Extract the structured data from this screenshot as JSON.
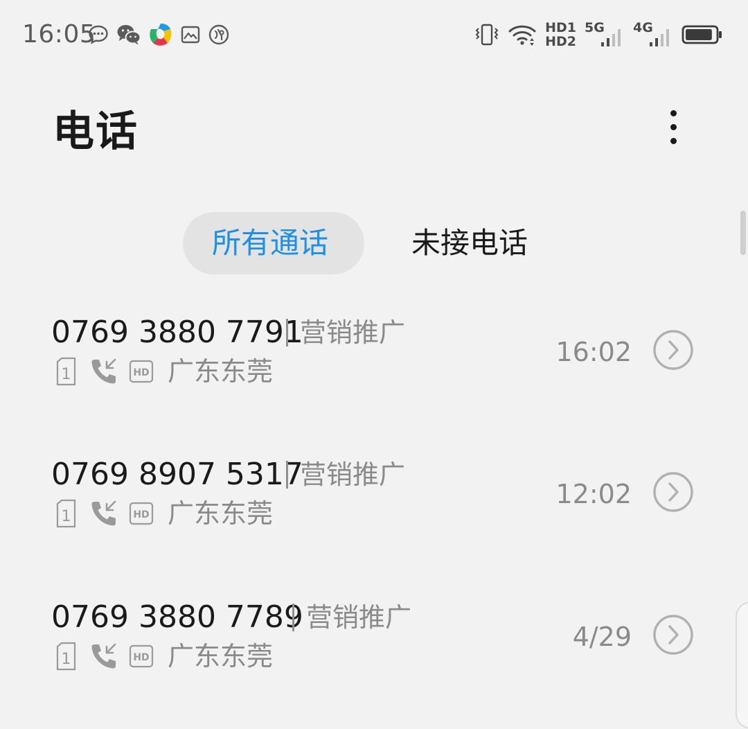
{
  "status_bar": {
    "time": "16:05",
    "left_icons": [
      "chat-bubble-icon",
      "wechat-icon",
      "colorful-app-icon",
      "gallery-icon",
      "nfc-icon"
    ],
    "right_icons": [
      "vibrate-icon",
      "wifi-icon",
      "hd-voice-icon",
      "signal-5g-icon",
      "signal-4g-icon",
      "battery-icon"
    ],
    "hd1_label": "HD1",
    "hd2_label": "HD2",
    "net1_label": "5G",
    "net2_label": "4G",
    "battery_level": 0.9
  },
  "header": {
    "title": "电话",
    "more_icon": "more-vertical-icon"
  },
  "tabs": [
    {
      "label": "所有通话",
      "active": true
    },
    {
      "label": "未接电话",
      "active": false
    }
  ],
  "calls": [
    {
      "number": "0769 3880 7791",
      "tag": "营销推广",
      "sim": "1",
      "call_type_icon": "incoming-call-icon",
      "hd_badge": "HD",
      "location": "广东东莞",
      "time": "16:02",
      "detail_icon": "chevron-right-circle-icon"
    },
    {
      "number": "0769 8907 5317",
      "tag": "营销推广",
      "sim": "1",
      "call_type_icon": "incoming-call-icon",
      "hd_badge": "HD",
      "location": "广东东莞",
      "time": "12:02",
      "detail_icon": "chevron-right-circle-icon"
    },
    {
      "number": "0769 3880 7789",
      "tag": "营销推广",
      "sim": "1",
      "call_type_icon": "incoming-call-icon",
      "hd_badge": "HD",
      "location": "广东东莞",
      "time": "4/29",
      "detail_icon": "chevron-right-circle-icon"
    }
  ],
  "colors": {
    "background": "#f2f2f2",
    "accent": "#1e8fe6",
    "active_tab_bg": "#e3e3e3",
    "primary_text": "#1a1a1a",
    "secondary_text": "#8a8a8a"
  }
}
